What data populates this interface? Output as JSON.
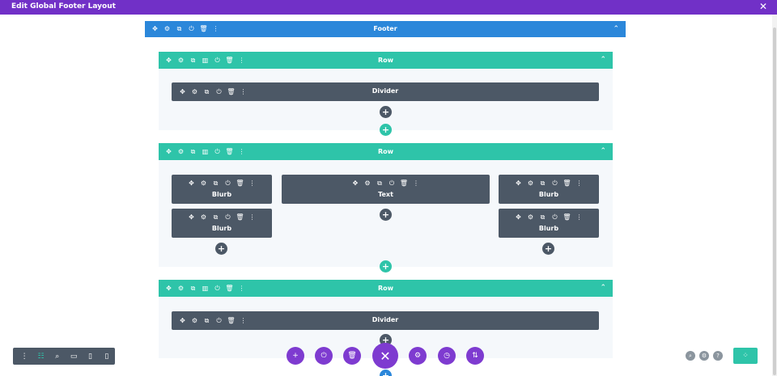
{
  "topbar": {
    "title": "Edit Global Footer Layout",
    "close_icon": "✕"
  },
  "section": {
    "label": "Footer",
    "collapse_icon": "⌃"
  },
  "icons": {
    "move": "✥",
    "settings": "⚙",
    "duplicate": "⧉",
    "columns": "▥",
    "power": "⏻",
    "trash": "🗑",
    "more": "⋮",
    "add": "+",
    "chevron": "⌃"
  },
  "rows": [
    {
      "label": "Row",
      "modules": [
        {
          "label": "Divider"
        }
      ]
    },
    {
      "label": "Row",
      "modules": [
        {
          "label": "Blurb"
        },
        {
          "label": "Blurb"
        },
        {
          "label": "Text"
        },
        {
          "label": "Blurb"
        },
        {
          "label": "Blurb"
        }
      ]
    },
    {
      "label": "Row",
      "modules": [
        {
          "label": "Divider"
        }
      ]
    }
  ],
  "page_actions": {
    "add": "+",
    "portability": "⏻",
    "clear": "🗑",
    "close": "✕",
    "settings": "⚙",
    "history": "◷",
    "sort": "⇅"
  },
  "view_bar": {
    "menu": "⋮",
    "wireframe": "☷",
    "zoom": "⌕",
    "desktop": "▭",
    "tablet": "▯",
    "phone": "▯"
  },
  "right_tools": {
    "search": "⌕",
    "settings": "⚙",
    "help": "?",
    "save": "⁘"
  },
  "colors": {
    "topbar": "#7130c7",
    "section": "#2b87da",
    "row": "#2ec4a9",
    "module": "#4c5866",
    "action": "#7e3bd0"
  }
}
